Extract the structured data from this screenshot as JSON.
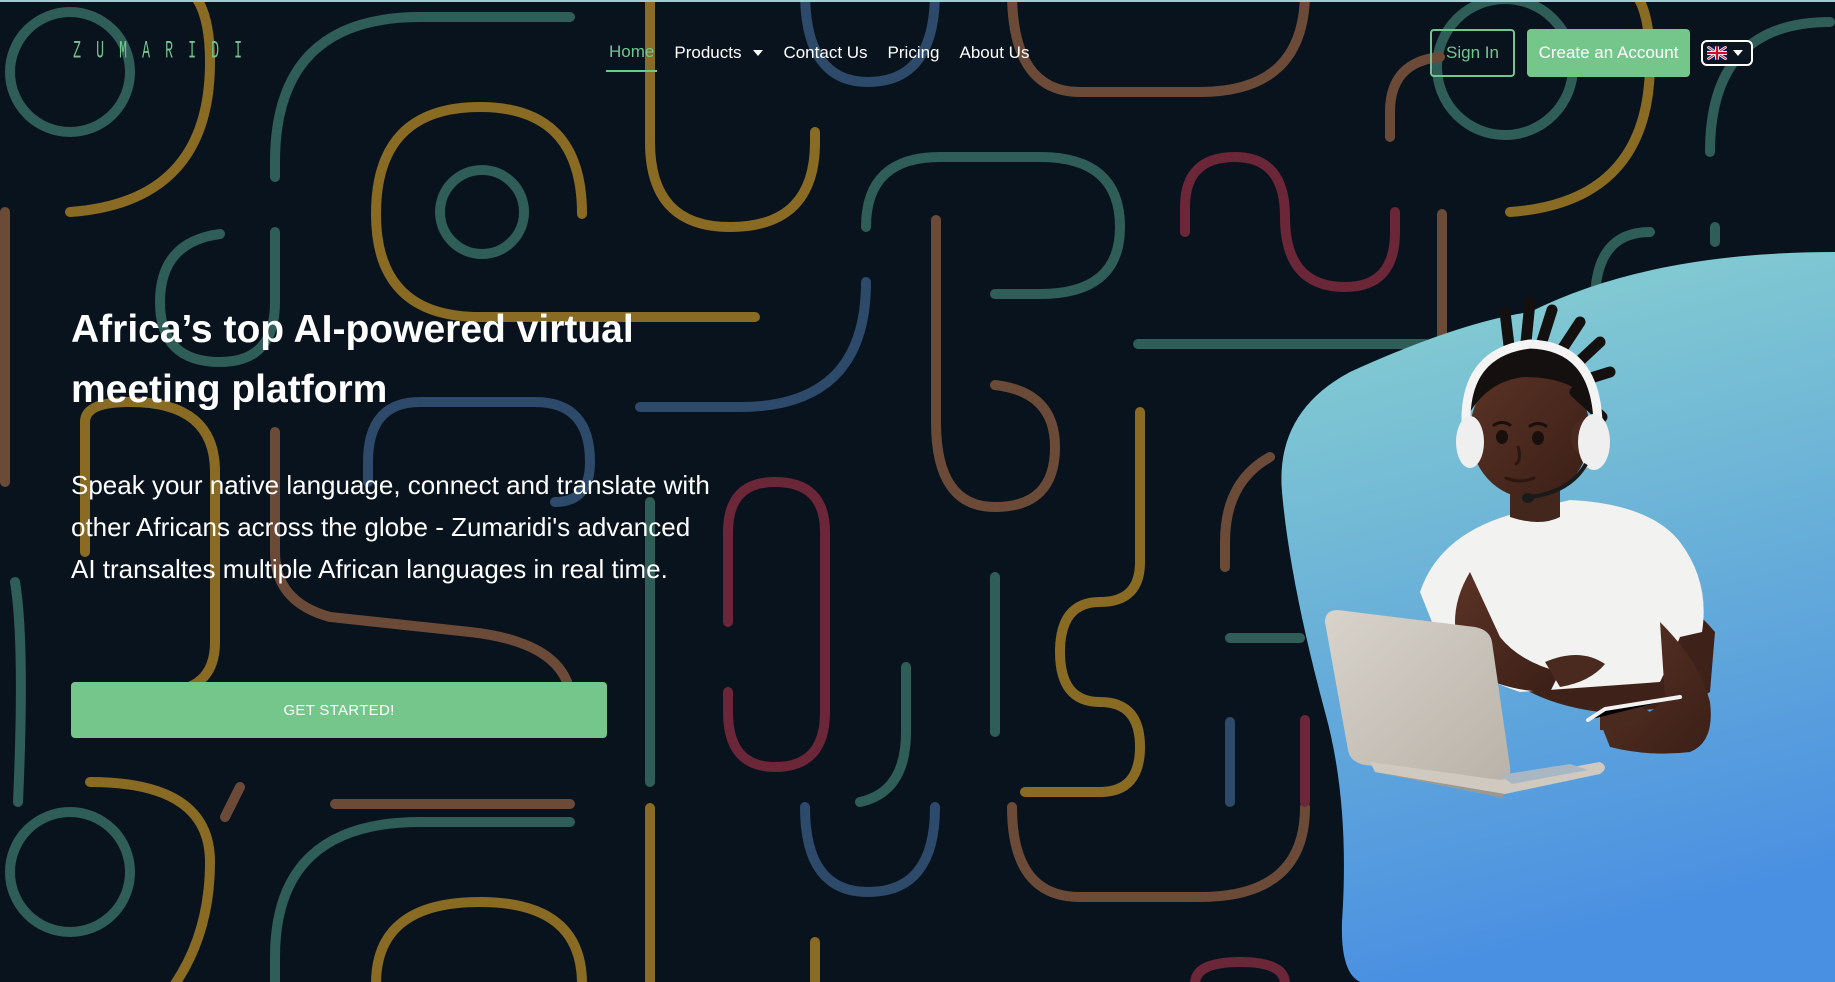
{
  "brand": {
    "logo_text": "ZUMARIDI",
    "accent_color": "#74c690"
  },
  "nav": {
    "items": [
      {
        "label": "Home",
        "active": true
      },
      {
        "label": "Products",
        "has_dropdown": true
      },
      {
        "label": "Contact Us"
      },
      {
        "label": "Pricing"
      },
      {
        "label": "About Us"
      }
    ],
    "sign_in_label": "Sign In",
    "create_account_label": "Create an Account",
    "language": {
      "selected_icon": "uk-flag-icon",
      "dropdown_icon": "chevron-down-icon"
    }
  },
  "hero": {
    "title": "Africa’s top AI-powered virtual meeting platform",
    "description": "Speak your native language, connect and translate with other Africans across the globe - Zumaridi's advanced AI transaltes multiple African languages in real time.",
    "cta_label": "GET STARTED!",
    "illustration": "person-with-headset-using-laptop"
  },
  "colors": {
    "background": "#08131d",
    "button_green": "#74c68a",
    "blob_top": "#8bd3cf",
    "blob_bottom": "#4a90e2"
  }
}
